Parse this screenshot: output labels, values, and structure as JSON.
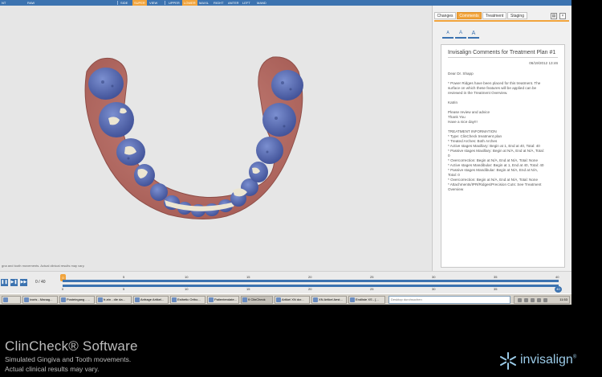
{
  "toolbar": {
    "items": [
      "NT",
      "RAW",
      "SIDE",
      "SUPER",
      "VIEW",
      "UPPER",
      "LOWER",
      "MAXIL",
      "RIGHT",
      "ANTER",
      "LEFT",
      "MAND"
    ],
    "active": [
      "SUPER",
      "LOWER"
    ]
  },
  "viewport": {
    "disclaimer": "gna and tooth movements. Actual clinical results may vary."
  },
  "panel": {
    "tabs": [
      "Changes",
      "Comments",
      "Treatment",
      "Staging"
    ],
    "active_tab": "Comments",
    "icons": [
      "print-icon",
      "close-icon"
    ],
    "font_buttons": [
      "A",
      "A",
      "A"
    ]
  },
  "comments": {
    "title": "Invisalign Comments for Treatment Plan #1",
    "date": "06/19/2012 13:46",
    "lines": [
      "Dear Dr. Shapp",
      "",
      "* Power Ridges have been placed for this treatment. The",
      "surface on which these features will be applied can be",
      "reviewed in the Treatment Overview.",
      "",
      "Katrin",
      "",
      "Please review and advice",
      "Thank You",
      "Have a nice day!!!",
      "",
      "TREATMENT INFORMATION",
      "* Type: ClinCheck treatment plan",
      "* Treated Arches: Both Arches",
      "* Active stages Maxillary: Begin at 1, End at 40, Total: 40",
      "* Passive stages Maxillary: Begin at N/A, End at N/A, Total:",
      "0",
      "* Overcorrection: Begin at N/A, End at N/A, Total: None",
      "* Active stages Mandibular: Begin at 1, End at 40, Total: 40",
      "* Passive stages Mandibular: Begin at N/A, End at N/A,",
      "Total: 0",
      "* Overcorrection: Begin at N/A, End at N/A, Total: None",
      "* Attachments/IPR/Ridges/Precision Cuts: See Treatment",
      "Overview"
    ]
  },
  "timeline": {
    "counter": "0 / 40",
    "ticks": [
      "0",
      "5",
      "10",
      "15",
      "20",
      "25",
      "30",
      "35",
      "40"
    ],
    "start_marker": "0",
    "end_marker": "40",
    "current_stage": 0,
    "total_stages": 40
  },
  "taskbar": {
    "items": [
      "",
      "ivoris - Manag...",
      "Posteingang - ...",
      "fr-ein - die da...",
      "Anfrage Artikel...",
      "Esthetic Ortho...",
      "Patientendate...",
      "9 ClinCheck",
      "Artikel XN dcr...",
      "XN Artikel Aest...",
      "Endliste XS - [..."
    ],
    "active": "9 ClinCheck",
    "search_placeholder": "Desktop durchsuchen",
    "time": "11:53"
  },
  "brand": {
    "title": "ClinCheck® Software",
    "subtitle_1": "Simulated Gingiva and Tooth movements.",
    "subtitle_2": "Actual clinical results may vary.",
    "logo": "invisalign",
    "logo_suffix": "®"
  },
  "colors": {
    "accent_blue": "#3c73b0",
    "accent_orange": "#f1a43c",
    "gingiva": "#b9706a",
    "tooth_blue": "#5a6fb2",
    "attachment": "#ece6d2",
    "logo": "#9bcbe8"
  }
}
